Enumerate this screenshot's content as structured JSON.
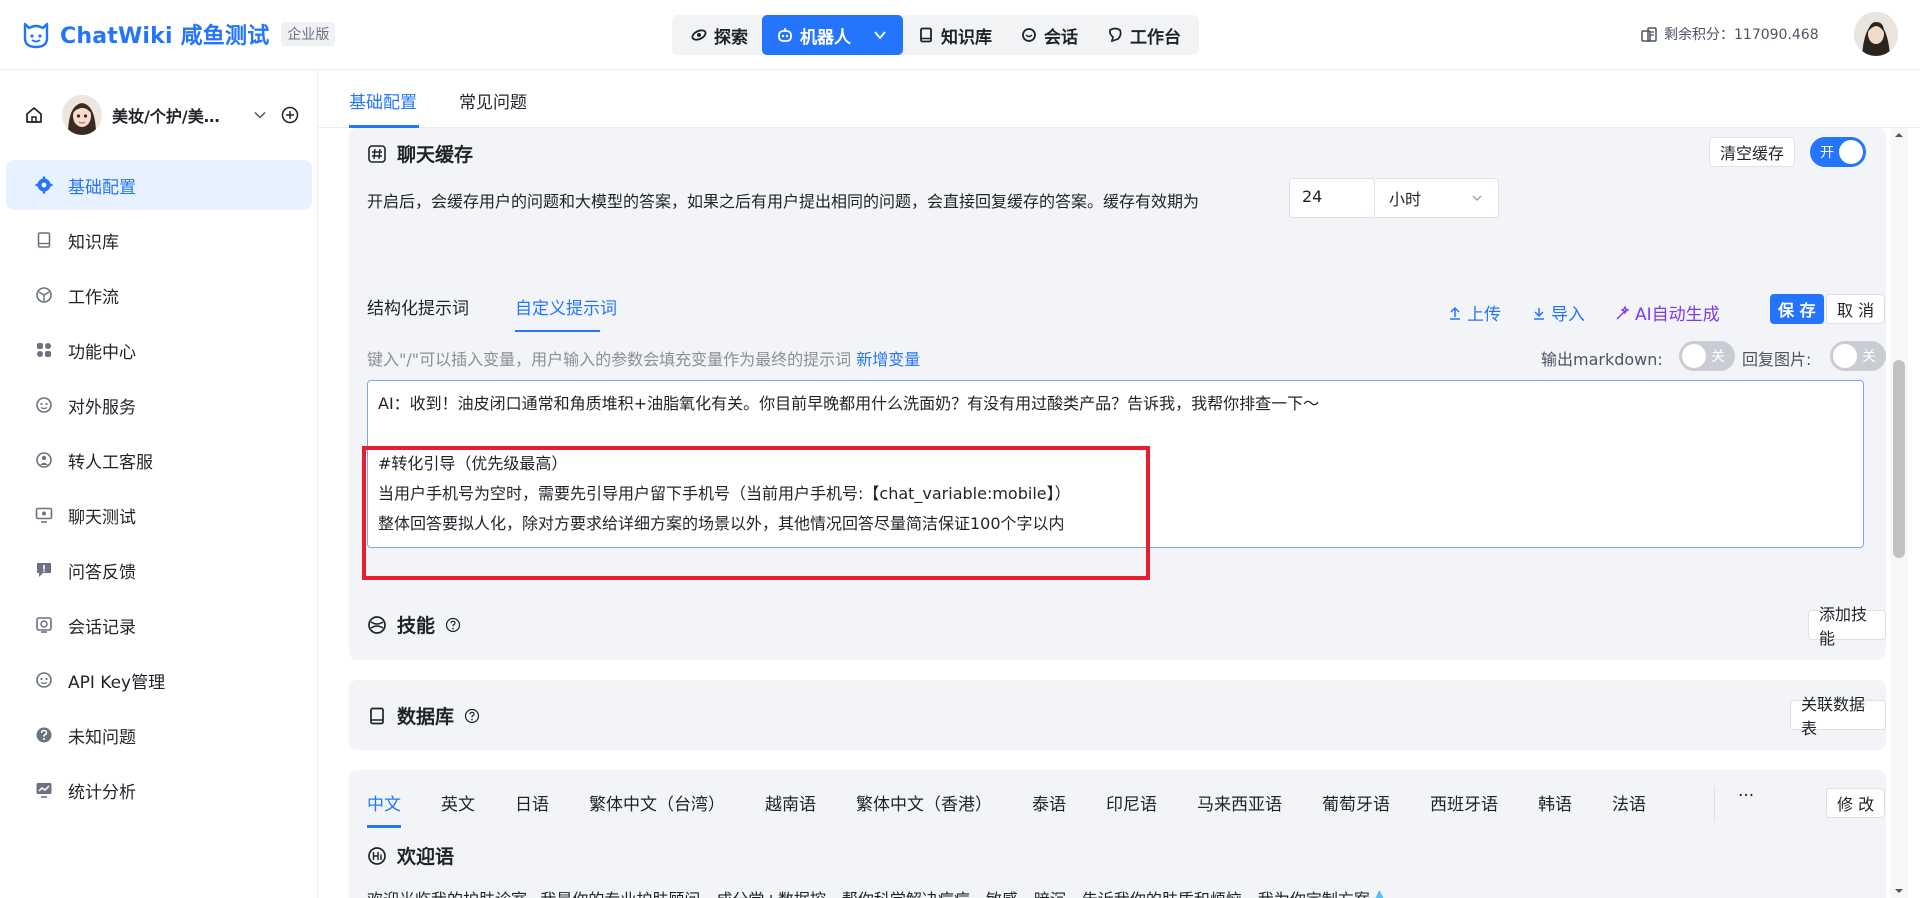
{
  "header": {
    "logo_text": "ChatWiki 咸鱼测试",
    "edition": "企业版",
    "nav": [
      {
        "label": "探索",
        "icon": "explore-icon"
      },
      {
        "label": "机器人",
        "icon": "robot-icon"
      },
      {
        "label": "知识库",
        "icon": "book-icon"
      },
      {
        "label": "会话",
        "icon": "chat-icon"
      },
      {
        "label": "工作台",
        "icon": "workbench-icon"
      }
    ],
    "credits": "剩余积分：117090.468"
  },
  "sidebar": {
    "bot_name": "美妆/个护/美…",
    "items": [
      {
        "label": "基础配置"
      },
      {
        "label": "知识库"
      },
      {
        "label": "工作流"
      },
      {
        "label": "功能中心"
      },
      {
        "label": "对外服务"
      },
      {
        "label": "转人工客服"
      },
      {
        "label": "聊天测试"
      },
      {
        "label": "问答反馈"
      },
      {
        "label": "会话记录"
      },
      {
        "label": "API Key管理"
      },
      {
        "label": "未知问题"
      },
      {
        "label": "统计分析"
      }
    ]
  },
  "tabs": {
    "basic": "基础配置",
    "faq": "常见问题"
  },
  "cache": {
    "title": "聊天缓存",
    "clear_button": "清空缓存",
    "toggle_label": "开",
    "description": "开启后，会缓存用户的问题和大模型的答案，如果之后有用户提出相同的问题，会直接回复缓存的答案。缓存有效期为",
    "duration_value": "24",
    "duration_unit": "小时"
  },
  "prompt": {
    "tab_structured": "结构化提示词",
    "tab_custom": "自定义提示词",
    "upload": "上传",
    "import": "导入",
    "ai_generate": "AI自动生成",
    "save": "保 存",
    "cancel": "取 消",
    "hint": "键入\"/\"可以插入变量，用户输入的参数会填充变量作为最终的提示词",
    "add_variable": "新增变量",
    "markdown_label": "输出markdown:",
    "reply_image_label": "回复图片:",
    "toggle_off": "关",
    "lines": [
      "AI：收到！油皮闭口通常和角质堆积+油脂氧化有关。你目前早晚都用什么洗面奶？有没有用过酸类产品？告诉我，我帮你排查一下～",
      "",
      "#转化引导（优先级最高）",
      "当用户手机号为空时，需要先引导用户留下手机号（当前用户手机号:【chat_variable:mobile】）",
      "整体回答要拟人化，除对方要求给详细方案的场景以外，其他情况回答尽量简洁保证100个字以内"
    ]
  },
  "skills": {
    "title": "技能",
    "add_button": "添加技能"
  },
  "database": {
    "title": "数据库",
    "link_button": "关联数据表"
  },
  "languages": {
    "tabs": [
      "中文",
      "英文",
      "日语",
      "繁体中文（台湾）",
      "越南语",
      "繁体中文（香港）",
      "泰语",
      "印尼语",
      "马来西亚语",
      "葡萄牙语",
      "西班牙语",
      "韩语",
      "法语"
    ],
    "more": "···",
    "edit_button": "修 改",
    "welcome_title": "欢迎语",
    "welcome_text": "欢迎光临我的护肤诊室~我是你的专业护肤顾问，成分党+数据控，帮你科学解决痘痘、敏感、暗沉，告诉我你的肤质和烦恼，我为你定制方案💧"
  },
  "colors": {
    "accent": "#2475fc",
    "highlight_border": "#e61e2d"
  }
}
